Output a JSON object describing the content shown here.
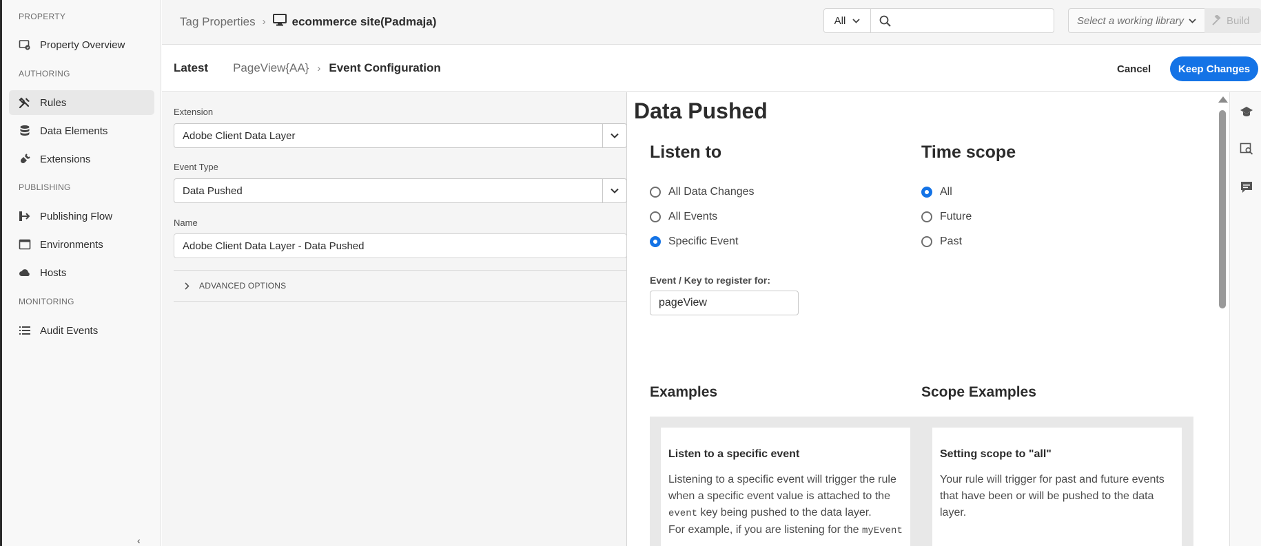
{
  "sidebar": {
    "sections": {
      "property": "PROPERTY",
      "authoring": "AUTHORING",
      "publishing": "PUBLISHING",
      "monitoring": "MONITORING"
    },
    "items": [
      {
        "label": "Property Overview",
        "icon": "property-overview-icon"
      },
      {
        "label": "Rules",
        "icon": "rules-icon",
        "active": true
      },
      {
        "label": "Data Elements",
        "icon": "data-elements-icon"
      },
      {
        "label": "Extensions",
        "icon": "extensions-icon"
      },
      {
        "label": "Publishing Flow",
        "icon": "publishing-flow-icon"
      },
      {
        "label": "Environments",
        "icon": "environments-icon"
      },
      {
        "label": "Hosts",
        "icon": "hosts-icon"
      },
      {
        "label": "Audit Events",
        "icon": "audit-events-icon"
      }
    ],
    "collapse_glyph": "‹"
  },
  "topbar": {
    "breadcrumb_root": "Tag Properties",
    "property_name": "ecommerce site(Padmaja)",
    "search_scope": "All",
    "search_value": "",
    "library_placeholder": "Select a working library",
    "build_label": "Build"
  },
  "subheader": {
    "latest": "Latest",
    "rule_name": "PageView{AA}",
    "current": "Event Configuration",
    "cancel": "Cancel",
    "keep_changes": "Keep Changes"
  },
  "form": {
    "extension_label": "Extension",
    "extension_value": "Adobe Client Data Layer",
    "event_type_label": "Event Type",
    "event_type_value": "Data Pushed",
    "name_label": "Name",
    "name_value": "Adobe Client Data Layer - Data Pushed",
    "advanced_options": "ADVANCED OPTIONS"
  },
  "config": {
    "title": "Data Pushed",
    "listen_to": {
      "heading": "Listen to",
      "options": [
        "All Data Changes",
        "All Events",
        "Specific Event"
      ],
      "selected": "Specific Event"
    },
    "time_scope": {
      "heading": "Time scope",
      "options": [
        "All",
        "Future",
        "Past"
      ],
      "selected": "All"
    },
    "event_key_label": "Event / Key to register for:",
    "event_key_value": "pageView",
    "examples_heading": "Examples",
    "scope_examples_heading": "Scope Examples",
    "example_card": {
      "title": "Listen to a specific event",
      "line1": "Listening to a specific event will trigger the rule when a specific event value is attached to the",
      "code1": "event",
      "line2": " key being pushed to the data layer.",
      "line3": "For example, if you are listening for the ",
      "code2": "myEvent"
    },
    "scope_card": {
      "title": "Setting scope to \"all\"",
      "body": "Your rule will trigger for past and future events that have been or will be pushed to the data layer."
    }
  },
  "colors": {
    "accent": "#1473e6",
    "sidebar_bg": "#f8f8f8",
    "active_item_bg": "#e8e8e8"
  }
}
